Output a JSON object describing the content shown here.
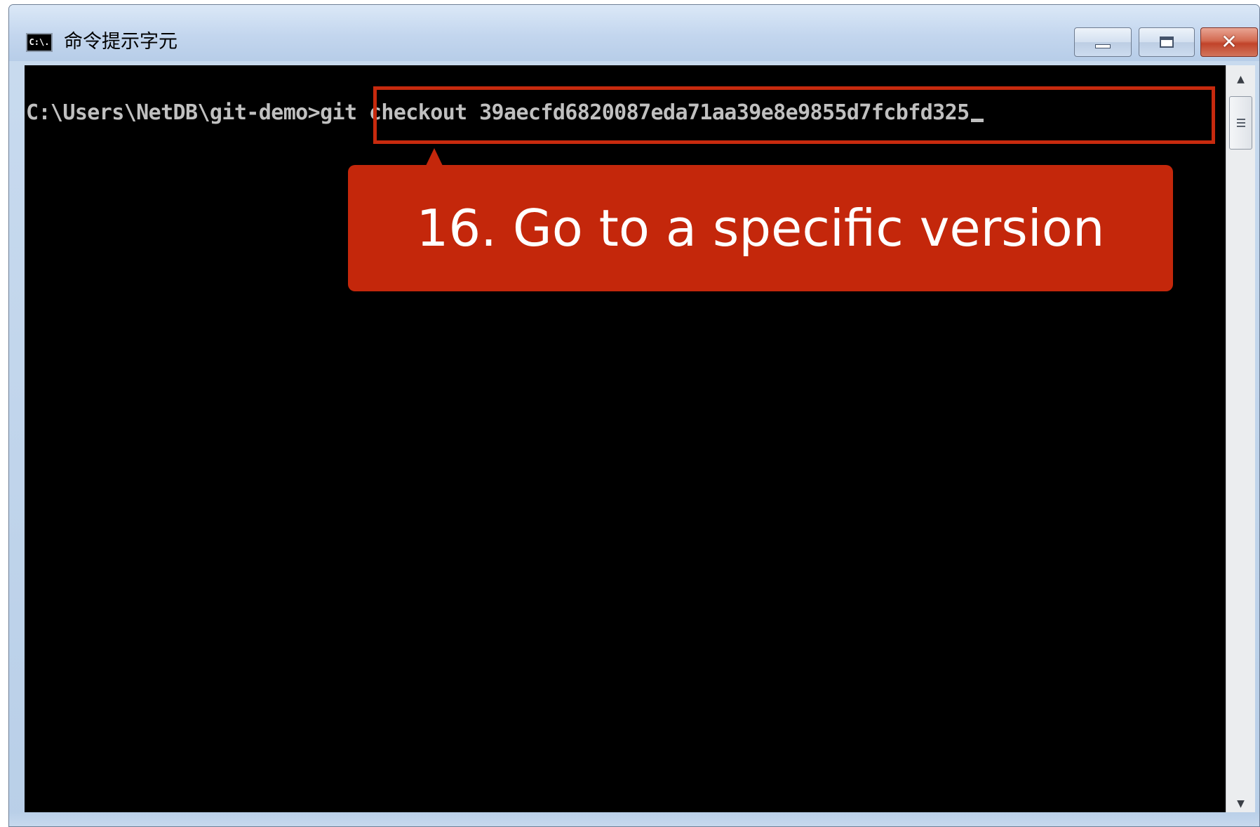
{
  "window": {
    "title": "命令提示字元",
    "icon_label": "C:\\.",
    "icon": "console-app-icon"
  },
  "controls": {
    "minimize_icon": "minimize-icon",
    "maximize_icon": "maximize-icon",
    "close_icon": "close-icon",
    "close_glyph": "✕"
  },
  "console": {
    "prompt": "C:\\Users\\NetDB\\git-demo>",
    "command": "git checkout 39aecfd6820087eda71aa39e8e9855d7fcbfd325"
  },
  "annotation": {
    "callout_text": "16. Go to a specific version",
    "color": "#c4270b"
  },
  "scrollbar": {
    "up_glyph": "▲",
    "down_glyph": "▼"
  }
}
